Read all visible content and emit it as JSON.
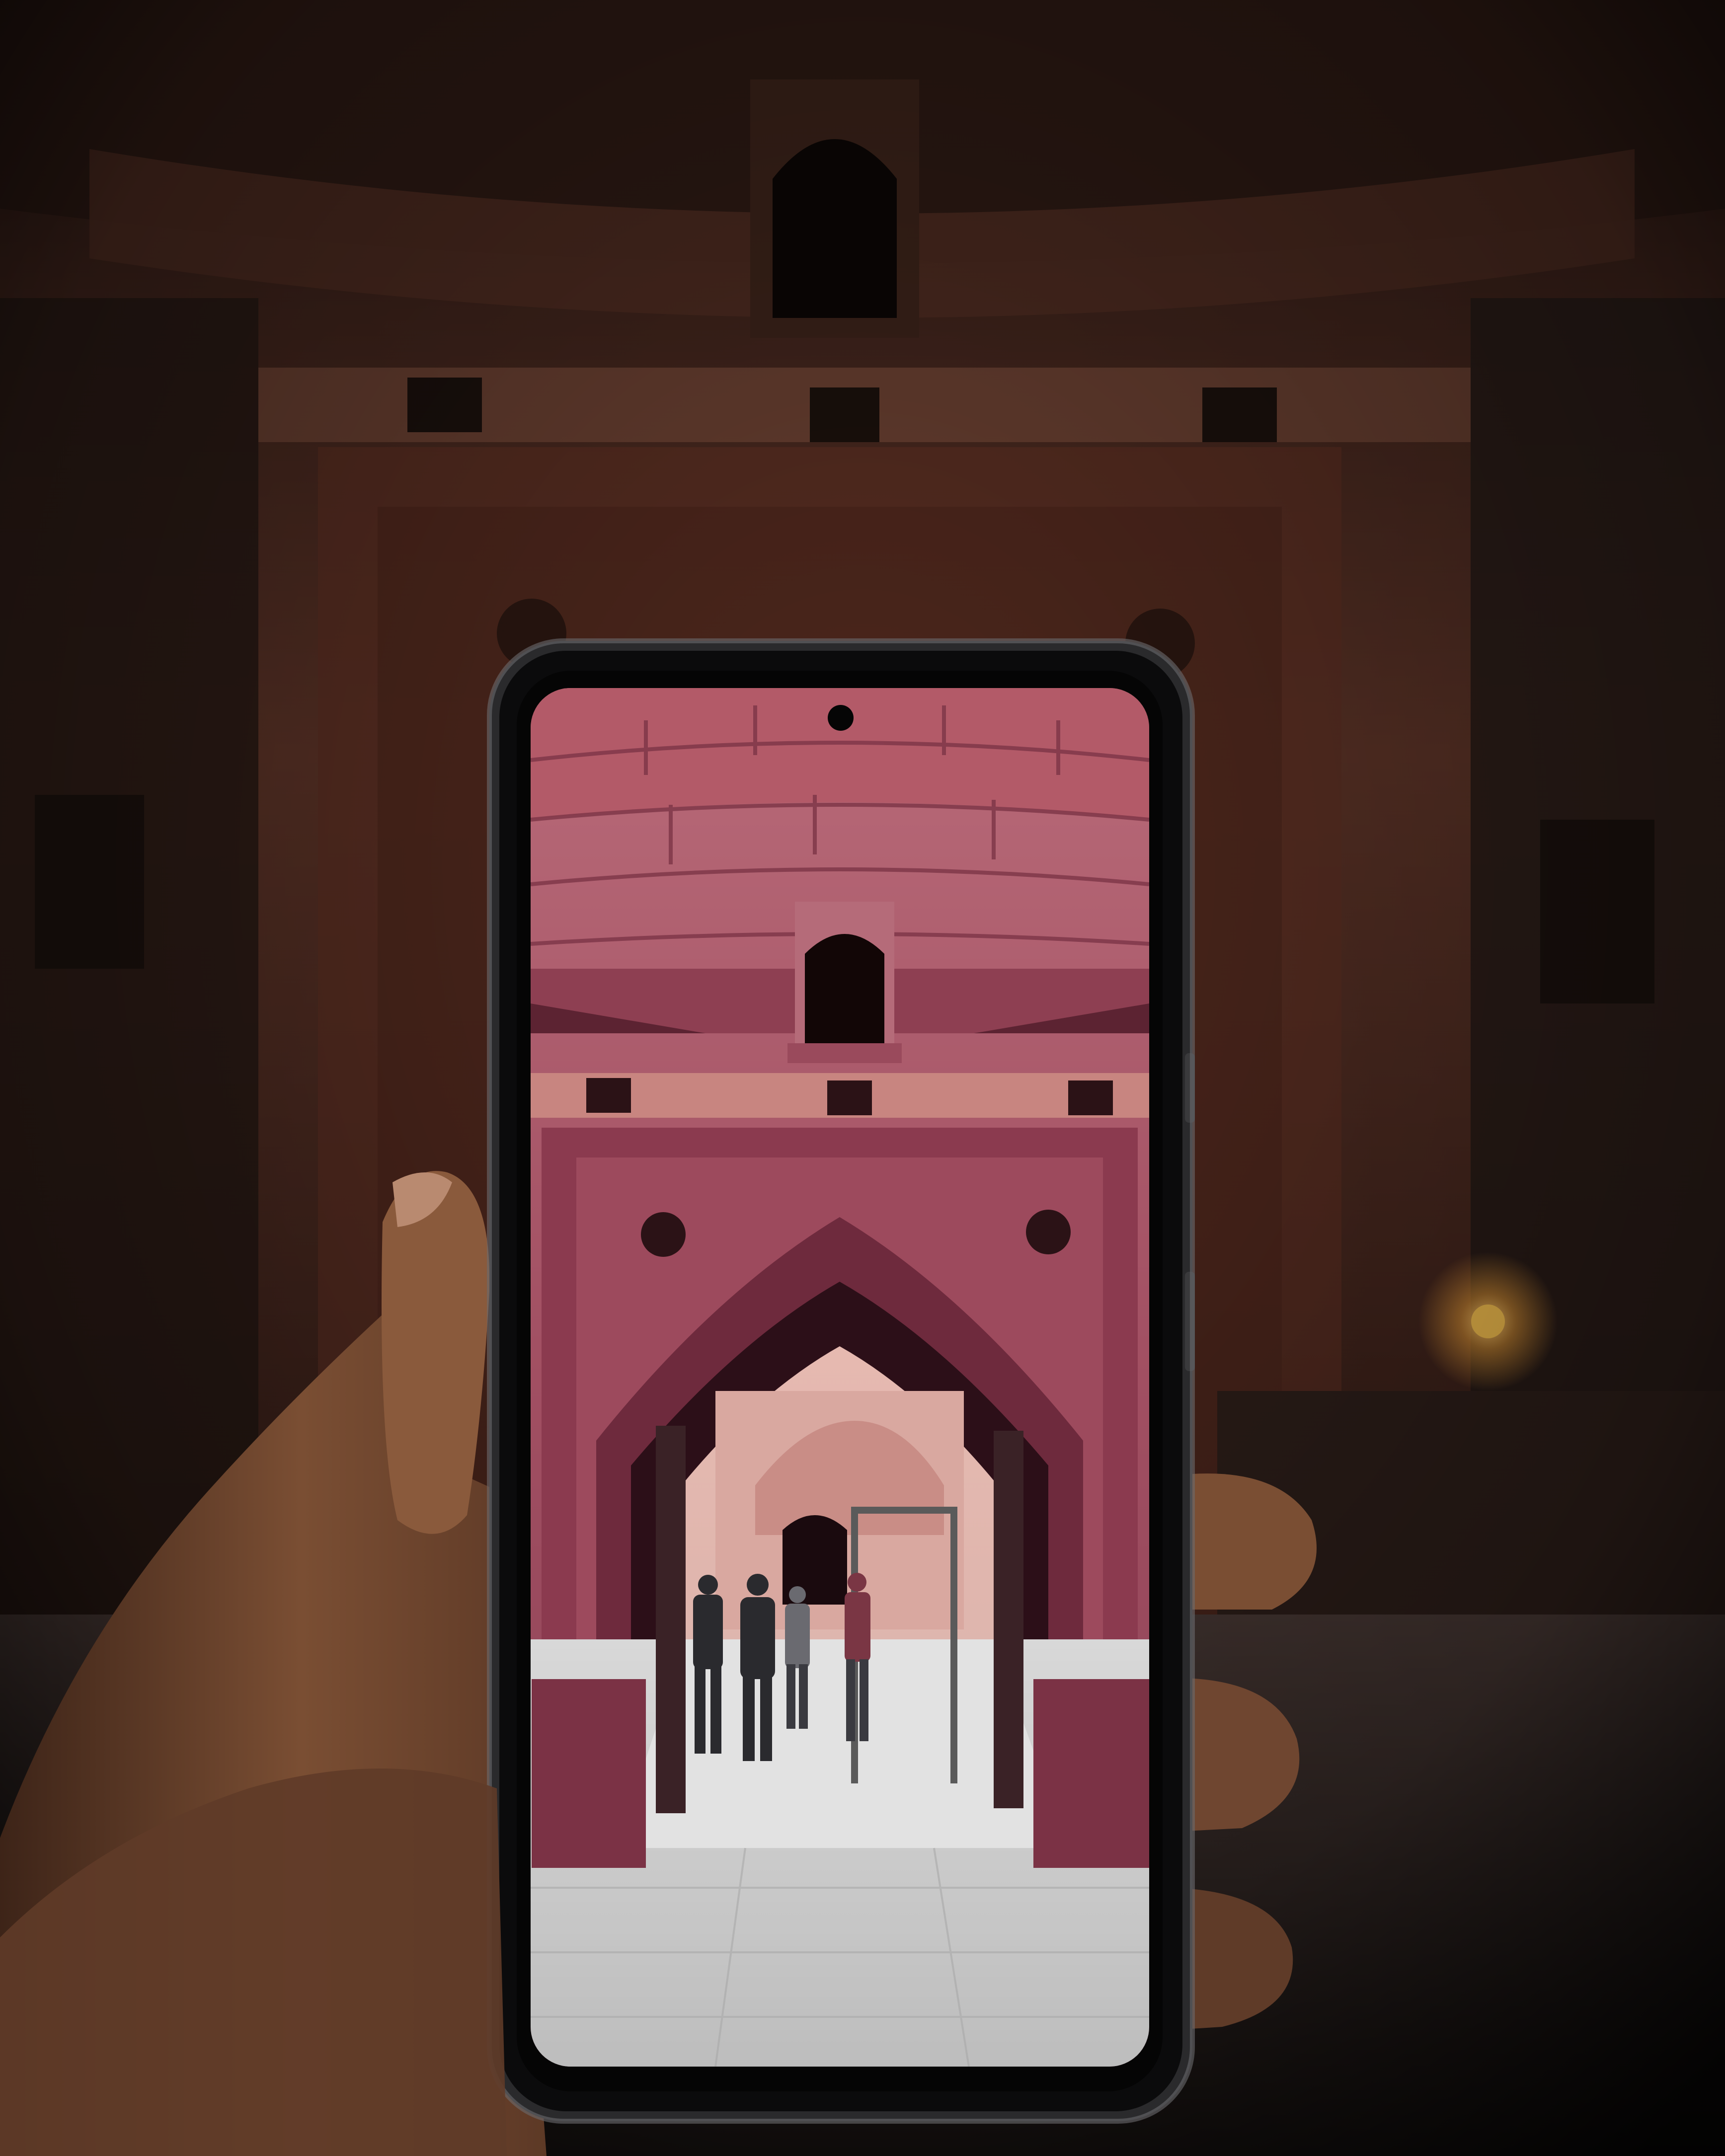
{
  "scene": {
    "background": {
      "wall_color": "#4a2a22",
      "door_color": "#5a2e22",
      "shadow_color": "#0c0807",
      "lamp_color": "#f2b845"
    },
    "phone": {
      "frame_color": "#1c1c1e",
      "bezel_color": "#050505",
      "screen_photo": {
        "stone_color": "#a8586a",
        "stone_light": "#c77d88",
        "floor_color": "#cfcfcf",
        "people_count": 4
      }
    },
    "hand": {
      "skin_color": "#7a4e33",
      "skin_shadow": "#3d2418"
    }
  }
}
